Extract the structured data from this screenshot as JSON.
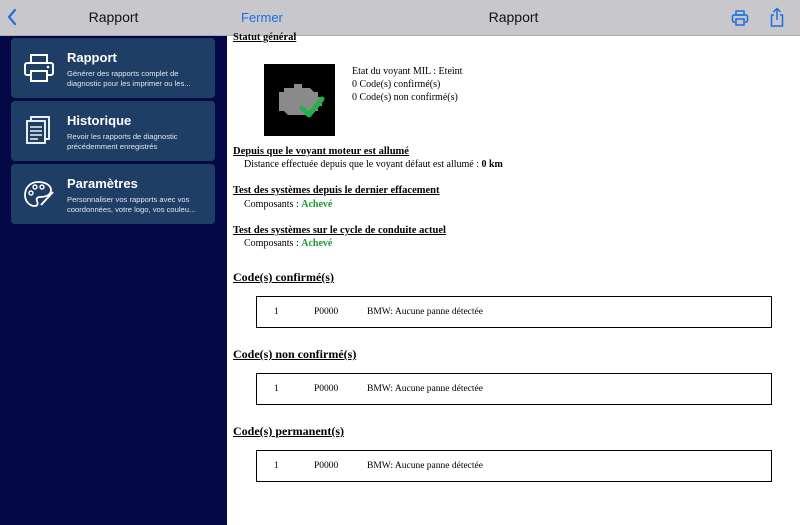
{
  "sidebar": {
    "title": "Rapport",
    "items": [
      {
        "title": "Rapport",
        "description": "Générer des rapports complet de diagnostic pour les imprimer ou les...",
        "icon": "printer-icon"
      },
      {
        "title": "Historique",
        "description": "Revoir les rapports de diagnostic précédemment enregistrés",
        "icon": "documents-icon"
      },
      {
        "title": "Paramètres",
        "description": "Personnaliser vos rapports avec vos coordonnées, votre logo, vos couleu...",
        "icon": "palette-icon"
      }
    ]
  },
  "header": {
    "close_label": "Fermer",
    "title": "Rapport",
    "print_icon": "printer-icon",
    "share_icon": "share-icon"
  },
  "report": {
    "status_title": "Statut général",
    "mil_status": "Etat du voyant MIL : Eteint",
    "confirmed_count": "0 Code(s) confirmé(s)",
    "unconfirmed_count": "0 Code(s) non confirmé(s)",
    "mil_on_title": "Depuis que le voyant moteur est allumé",
    "distance_label": "Distance effectuée depuis que le voyant défaut est allumé :",
    "distance_value": "0 km",
    "test_since_clear_title": "Test des systèmes depuis le dernier effacement",
    "components_label": "Composants :",
    "test_since_clear_value": "Achevé",
    "test_cycle_title": "Test des systèmes sur le cycle de conduite actuel",
    "test_cycle_value": "Achevé",
    "sections": [
      {
        "title": "Code(s) confirmé(s)",
        "row": {
          "num": "1",
          "code": "P0000",
          "desc": "BMW: Aucune panne détectée"
        }
      },
      {
        "title": "Code(s) non confirmé(s)",
        "row": {
          "num": "1",
          "code": "P0000",
          "desc": "BMW: Aucune panne détectée"
        }
      },
      {
        "title": "Code(s) permanent(s)",
        "row": {
          "num": "1",
          "code": "P0000",
          "desc": "BMW: Aucune panne détectée"
        }
      }
    ]
  },
  "colors": {
    "sidebar_bg": "#050846",
    "card_bg": "#1f3e66",
    "accent": "#1d6fe0",
    "ok_green": "#1a9b2e"
  }
}
